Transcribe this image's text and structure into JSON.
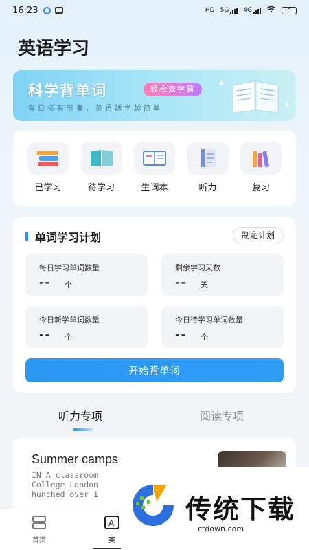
{
  "status_bar": {
    "time": "16:23",
    "network_1": "HD",
    "network_2": "5G",
    "network_3": "4G",
    "battery": "6"
  },
  "header": {
    "title": "英语学习"
  },
  "banner": {
    "title": "科学背单词",
    "badge": "轻松变学霸",
    "subtitle": "有目标有节奏，英语越学越简单"
  },
  "categories": [
    {
      "label": "已学习",
      "icon": "stack-books-icon"
    },
    {
      "label": "待学习",
      "icon": "open-book-icon"
    },
    {
      "label": "生词本",
      "icon": "notebook-icon"
    },
    {
      "label": "听力",
      "icon": "document-icon"
    },
    {
      "label": "复习",
      "icon": "books-shelf-icon"
    }
  ],
  "plan": {
    "title": "单词学习计划",
    "button": "制定计划",
    "stats": [
      {
        "label": "每日学习单词数量",
        "value": "--",
        "unit": "个"
      },
      {
        "label": "剩余学习天数",
        "value": "--",
        "unit": "天"
      },
      {
        "label": "今日新学单词数量",
        "value": "--",
        "unit": "个"
      },
      {
        "label": "今日待学习单词数量",
        "value": "--",
        "unit": "个"
      }
    ],
    "start_button": "开始背单词"
  },
  "tabs": [
    {
      "label": "听力专项",
      "active": true
    },
    {
      "label": "阅读专项",
      "active": false
    }
  ],
  "article": {
    "title": "Summer camps",
    "lines": [
      "IN A classroom",
      "College London",
      "hunched over 1"
    ]
  },
  "bottom_nav": [
    {
      "label": "首页",
      "icon": "home-icon"
    },
    {
      "label": "英",
      "icon": "translate-icon"
    }
  ],
  "watermark": {
    "text": "传统下载",
    "url": "ctdown.com"
  },
  "colors": {
    "accent": "#2a97f4",
    "badge": "#ff7fb3"
  }
}
